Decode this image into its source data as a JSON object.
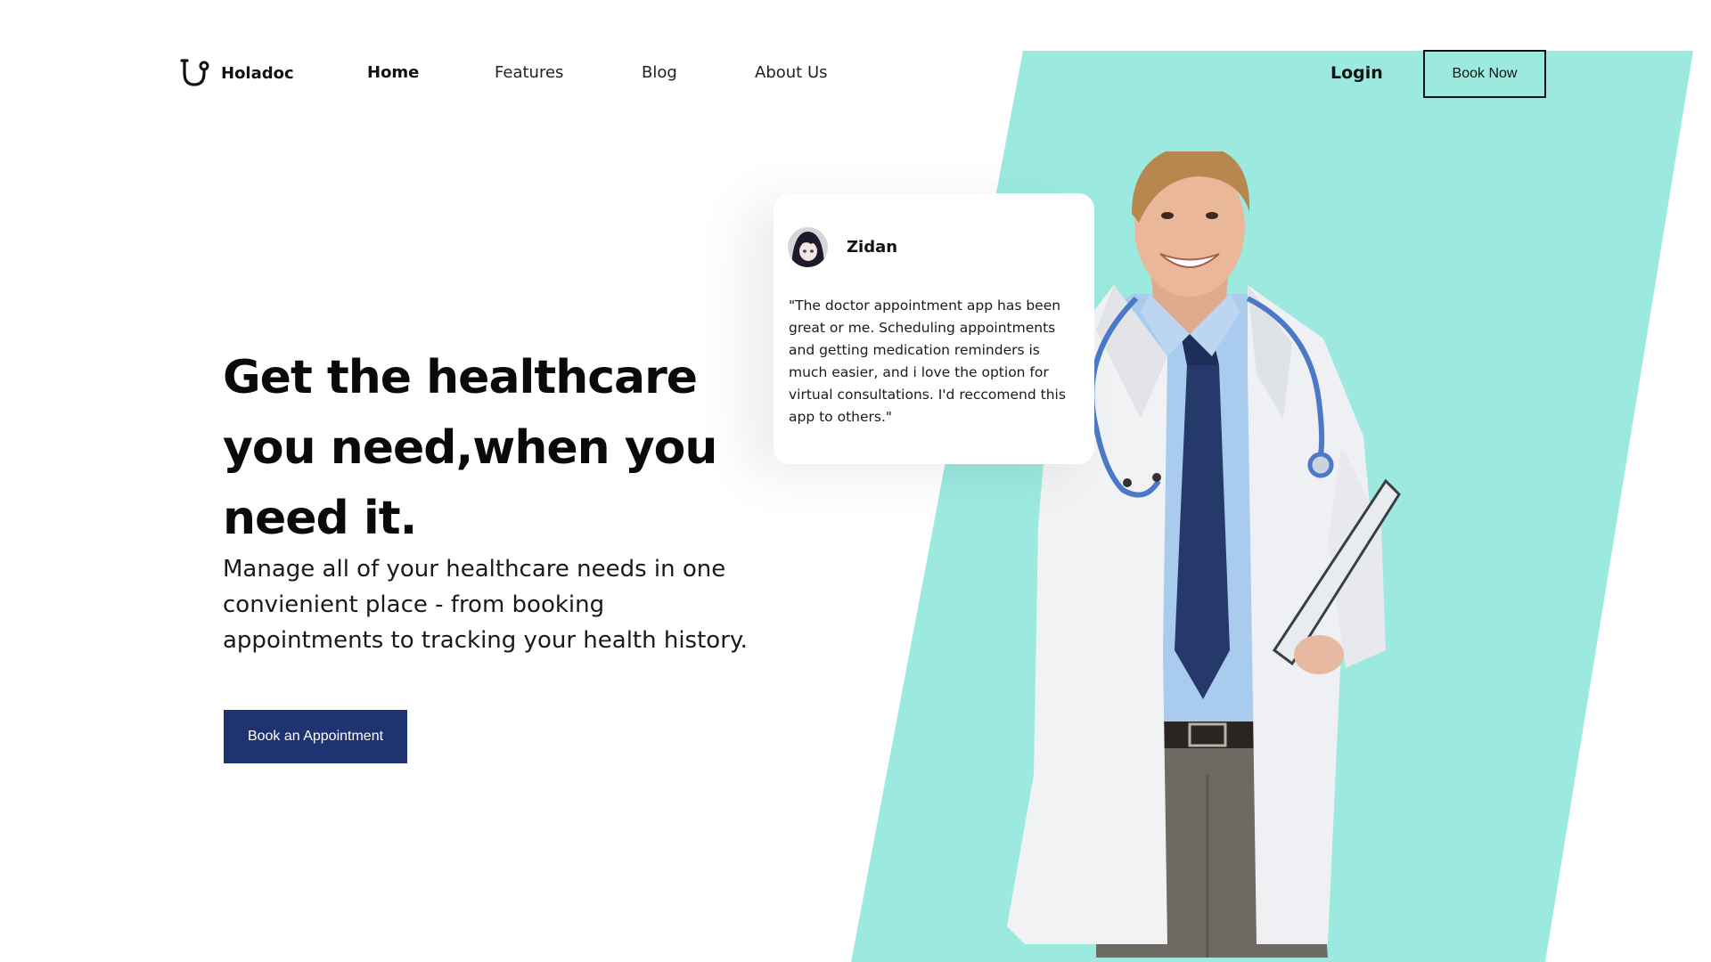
{
  "brand": {
    "name": "Holadoc",
    "icon": "stethoscope-icon"
  },
  "nav": {
    "links": [
      "Home",
      "Features",
      "Blog",
      "About Us"
    ],
    "active": "Home",
    "login_label": "Login",
    "book_now_label": "Book Now"
  },
  "hero": {
    "title": "Get the healthcare you need,when you need it.",
    "subtitle": "Manage all of your healthcare needs in one convienient place - from booking appointments to tracking your health history.",
    "cta_label": "Book an Appointment"
  },
  "testimonial": {
    "name": "Zidan",
    "quote": "\"The doctor appointment app has been great or me. Scheduling appointments and getting medication reminders is much easier, and i love the option for virtual consultations. I'd reccomend this app to others.\""
  },
  "colors": {
    "accent": "#9ceadf",
    "primary_button": "#1f3272",
    "text": "#0a0a0a"
  }
}
